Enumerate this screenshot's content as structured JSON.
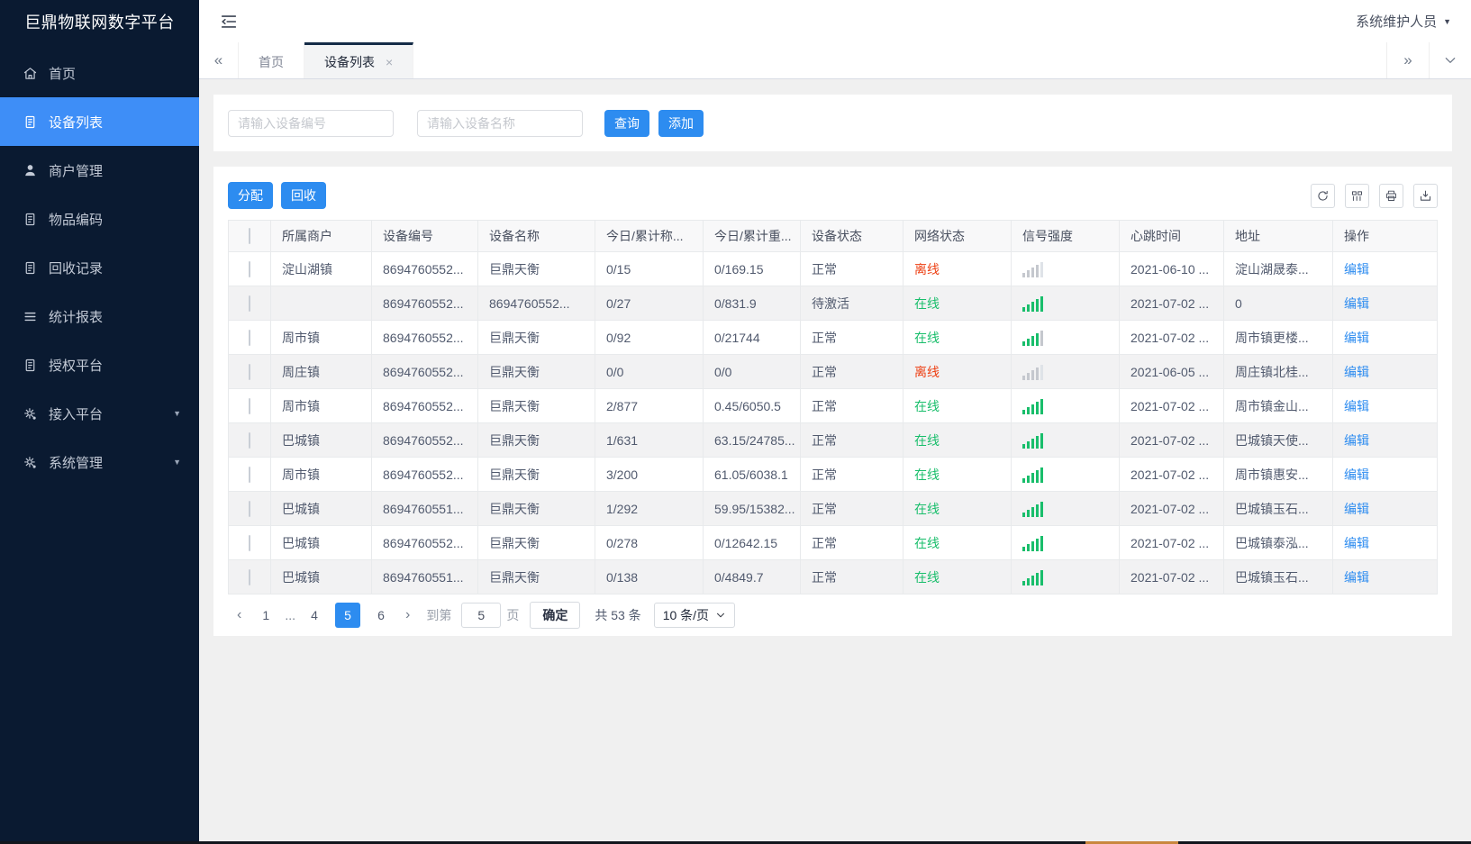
{
  "app": {
    "title": "巨鼎物联网数字平台"
  },
  "header": {
    "user_name": "系统维护人员",
    "collapse_icon": "menu-fold-icon",
    "user_caret_icon": "caret-down-icon"
  },
  "colors": {
    "primary": "#2d8cf0",
    "sidebar_bg": "#0a1a31",
    "sidebar_active": "#3e8ef7",
    "online": "#19be6b",
    "offline": "#ed4014",
    "link": "#2d8cf0"
  },
  "sidebar": {
    "items": [
      {
        "name": "home",
        "icon": "home-icon",
        "label": "首页"
      },
      {
        "name": "device-list",
        "icon": "document-icon",
        "label": "设备列表",
        "active": true
      },
      {
        "name": "merchant-mgmt",
        "icon": "person-icon",
        "label": "商户管理"
      },
      {
        "name": "item-code",
        "icon": "document-icon",
        "label": "物品编码"
      },
      {
        "name": "recycle-record",
        "icon": "document-icon",
        "label": "回收记录"
      },
      {
        "name": "stat-report",
        "icon": "list-icon",
        "label": "统计报表"
      },
      {
        "name": "auth-platform",
        "icon": "document-icon",
        "label": "授权平台"
      },
      {
        "name": "access-platform",
        "icon": "gear-icon",
        "label": "接入平台",
        "expandable": true
      },
      {
        "name": "system-mgmt",
        "icon": "gear-icon",
        "label": "系统管理",
        "expandable": true
      }
    ]
  },
  "tabs": {
    "scroll_left_icon": "chevrons-left-icon",
    "scroll_right_icon": "chevrons-right-icon",
    "menu_icon": "chevron-down-icon",
    "items": [
      {
        "label": "首页"
      },
      {
        "label": "设备列表",
        "active": true,
        "closable": true
      }
    ]
  },
  "search": {
    "device_no_placeholder": "请输入设备编号",
    "device_name_placeholder": "请输入设备名称",
    "query_label": "查询",
    "add_label": "添加"
  },
  "toolbar": {
    "assign_label": "分配",
    "recycle_label": "回收",
    "icon_buttons": [
      "refresh-icon",
      "columns-icon",
      "print-icon",
      "export-icon"
    ]
  },
  "table": {
    "columns": [
      "所属商户",
      "设备编号",
      "设备名称",
      "今日/累计称...",
      "今日/累计重...",
      "设备状态",
      "网络状态",
      "信号强度",
      "心跳时间",
      "地址",
      "操作"
    ],
    "edit_label": "编辑",
    "rows": [
      {
        "merchant": "淀山湖镇",
        "device_no": "8694760552...",
        "device_name": "巨鼎天衡",
        "count": "0/15",
        "weight": "0/169.15",
        "device_status": "正常",
        "network_status": "离线",
        "online": false,
        "signal_level": 4,
        "heartbeat": "2021-06-10 ...",
        "address": "淀山湖晟泰..."
      },
      {
        "merchant": "",
        "device_no": "8694760552...",
        "device_name": "8694760552...",
        "count": "0/27",
        "weight": "0/831.9",
        "device_status": "待激活",
        "network_status": "在线",
        "online": true,
        "signal_level": 5,
        "heartbeat": "2021-07-02 ...",
        "address": "0"
      },
      {
        "merchant": "周市镇",
        "device_no": "8694760552...",
        "device_name": "巨鼎天衡",
        "count": "0/92",
        "weight": "0/21744",
        "device_status": "正常",
        "network_status": "在线",
        "online": true,
        "signal_level": 4,
        "heartbeat": "2021-07-02 ...",
        "address": "周市镇更楼..."
      },
      {
        "merchant": "周庄镇",
        "device_no": "8694760552...",
        "device_name": "巨鼎天衡",
        "count": "0/0",
        "weight": "0/0",
        "device_status": "正常",
        "network_status": "离线",
        "online": false,
        "signal_level": 4,
        "heartbeat": "2021-06-05 ...",
        "address": "周庄镇北桂..."
      },
      {
        "merchant": "周市镇",
        "device_no": "8694760552...",
        "device_name": "巨鼎天衡",
        "count": "2/877",
        "weight": "0.45/6050.5",
        "device_status": "正常",
        "network_status": "在线",
        "online": true,
        "signal_level": 5,
        "heartbeat": "2021-07-02 ...",
        "address": "周市镇金山..."
      },
      {
        "merchant": "巴城镇",
        "device_no": "8694760552...",
        "device_name": "巨鼎天衡",
        "count": "1/631",
        "weight": "63.15/24785...",
        "device_status": "正常",
        "network_status": "在线",
        "online": true,
        "signal_level": 5,
        "heartbeat": "2021-07-02 ...",
        "address": "巴城镇天使..."
      },
      {
        "merchant": "周市镇",
        "device_no": "8694760552...",
        "device_name": "巨鼎天衡",
        "count": "3/200",
        "weight": "61.05/6038.1",
        "device_status": "正常",
        "network_status": "在线",
        "online": true,
        "signal_level": 5,
        "heartbeat": "2021-07-02 ...",
        "address": "周市镇惠安..."
      },
      {
        "merchant": "巴城镇",
        "device_no": "8694760551...",
        "device_name": "巨鼎天衡",
        "count": "1/292",
        "weight": "59.95/15382...",
        "device_status": "正常",
        "network_status": "在线",
        "online": true,
        "signal_level": 5,
        "heartbeat": "2021-07-02 ...",
        "address": "巴城镇玉石..."
      },
      {
        "merchant": "巴城镇",
        "device_no": "8694760552...",
        "device_name": "巨鼎天衡",
        "count": "0/278",
        "weight": "0/12642.15",
        "device_status": "正常",
        "network_status": "在线",
        "online": true,
        "signal_level": 5,
        "heartbeat": "2021-07-02 ...",
        "address": "巴城镇泰泓..."
      },
      {
        "merchant": "巴城镇",
        "device_no": "8694760551...",
        "device_name": "巨鼎天衡",
        "count": "0/138",
        "weight": "0/4849.7",
        "device_status": "正常",
        "network_status": "在线",
        "online": true,
        "signal_level": 5,
        "heartbeat": "2021-07-02 ...",
        "address": "巴城镇玉石..."
      }
    ]
  },
  "pagination": {
    "prev_icon": "chevron-left-icon",
    "next_icon": "chevron-right-icon",
    "pages": [
      {
        "label": "1"
      },
      {
        "label": "...",
        "ellipsis": true
      },
      {
        "label": "4"
      },
      {
        "label": "5",
        "active": true
      },
      {
        "label": "6"
      }
    ],
    "goto_prefix": "到第",
    "goto_value": "5",
    "goto_unit": "页",
    "confirm_label": "确定",
    "total_text": "共 53 条",
    "page_size_value": "10 条/页"
  }
}
